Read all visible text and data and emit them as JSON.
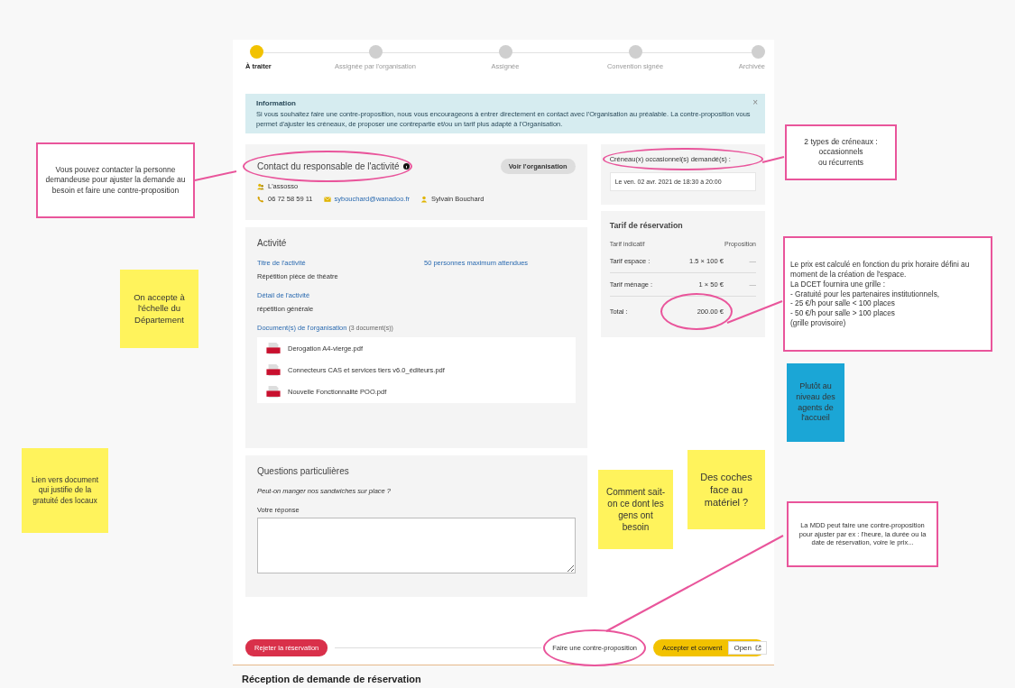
{
  "stepper": {
    "steps": [
      {
        "label": "À traiter",
        "selected": true
      },
      {
        "label": "Assignée par l'organisation",
        "selected": false
      },
      {
        "label": "Assignée",
        "selected": false
      },
      {
        "label": "Convention signée",
        "selected": false
      },
      {
        "label": "Archivée",
        "selected": false
      }
    ]
  },
  "notes_left": [
    {
      "kind": "comment",
      "color": "#e9559b",
      "text": "Vous pouvez contacter la personne demandeuse pour ajuster la demande au besoin et faire une contre-proposition"
    },
    {
      "kind": "sticky",
      "color": "#fff35c",
      "text": "On accepte à l'échelle du Département"
    },
    {
      "kind": "sticky",
      "color": "#fff35c",
      "text": "Lien vers document qui justifie de la gratuité des locaux"
    }
  ],
  "info": {
    "title": "Information",
    "text": "Si vous souhaitez faire une contre-proposition, nous vous encourageons à entrer directement en contact avec l'Organisation au préalable. La contre-proposition vous permet d'ajuster les créneaux, de proposer une contrepartie et/ou un tarif plus adapté à l'Organisation.",
    "close": "×"
  },
  "contact": {
    "title": "Contact du responsable de l'activité",
    "button": "Voir l'organisation",
    "organisation": "L'assosso",
    "phone": "06 72 58 59 11",
    "email": "sybouchard@wanadoo.fr",
    "person": "Sylvain Bouchard"
  },
  "activity": {
    "title": "Activité",
    "title_label": "Titre de l'activité",
    "title_value": "Répétition pièce de théatre",
    "attendees": "50 personnes maximum attendues",
    "detail_label": "Détail de l'activité",
    "detail_value": "répétition générale",
    "documents_label": "Document(s) de l'organisation",
    "documents_count": "(3 document(s))",
    "documents": [
      "Derogation A4-vierge.pdf",
      "Connecteurs CAS et services tiers v6.0_éditeurs.pdf",
      "Nouvelle Fonctionnalité POO.pdf"
    ]
  },
  "questions": {
    "title": "Questions particulières",
    "question": "Peut-on manger nos sandwiches sur place ?",
    "answer_label": "Votre réponse"
  },
  "slots": {
    "title": "Créneau(x) occasionnel(s) demandé(s) :",
    "slot": "Le ven. 02 avr. 2021 de 18:30 à 20:00"
  },
  "tarif": {
    "title": "Tarif de réservation",
    "col_1": "Tarif indicatif",
    "col_2": "Proposition",
    "rows": [
      {
        "label": "Tarif espace :",
        "value": "1.5 × 100 €",
        "proposal": "—"
      },
      {
        "label": "Tarif ménage :",
        "value": "1 × 50 €",
        "proposal": "—"
      }
    ],
    "total_label": "Total :",
    "total": "200.00 €"
  },
  "notes_right": [
    {
      "kind": "comment",
      "color": "#e9559b",
      "text": "2 types de créneaux :\noccasionnels\nou récurrents"
    },
    {
      "kind": "comment",
      "color": "#e9559b",
      "text": "Le prix est calculé en fonction du prix horaire défini au moment de la création de l'espace.\nLa DCET fournira une grille :\n- Gratuité pour les partenaires institutionnels,\n- 25 €/h pour salle  < 100 places\n- 50 €/h pour salle > 100 places\n(grille provisoire)"
    },
    {
      "kind": "sticky",
      "color": "#1ba6d6",
      "text": "Plutôt au niveau des agents de l'accueil"
    },
    {
      "kind": "sticky",
      "color": "#fff35c",
      "text": "Comment sait-on ce dont les gens ont besoin"
    },
    {
      "kind": "sticky",
      "color": "#fff35c",
      "text": "Des coches face au matériel ?"
    },
    {
      "kind": "comment",
      "color": "#e9559b",
      "text": "La MDD peut faire une contre-proposition pour ajuster par ex : l'heure, la durée ou la date de réservation, voire le prix..."
    }
  ],
  "actions": {
    "reject": "Rejeter la réservation",
    "counter": "Faire une contre-proposition",
    "accept": "Accepter et convent"
  },
  "open_badge": "Open",
  "next_frame_title": "Réception de demande de réservation"
}
